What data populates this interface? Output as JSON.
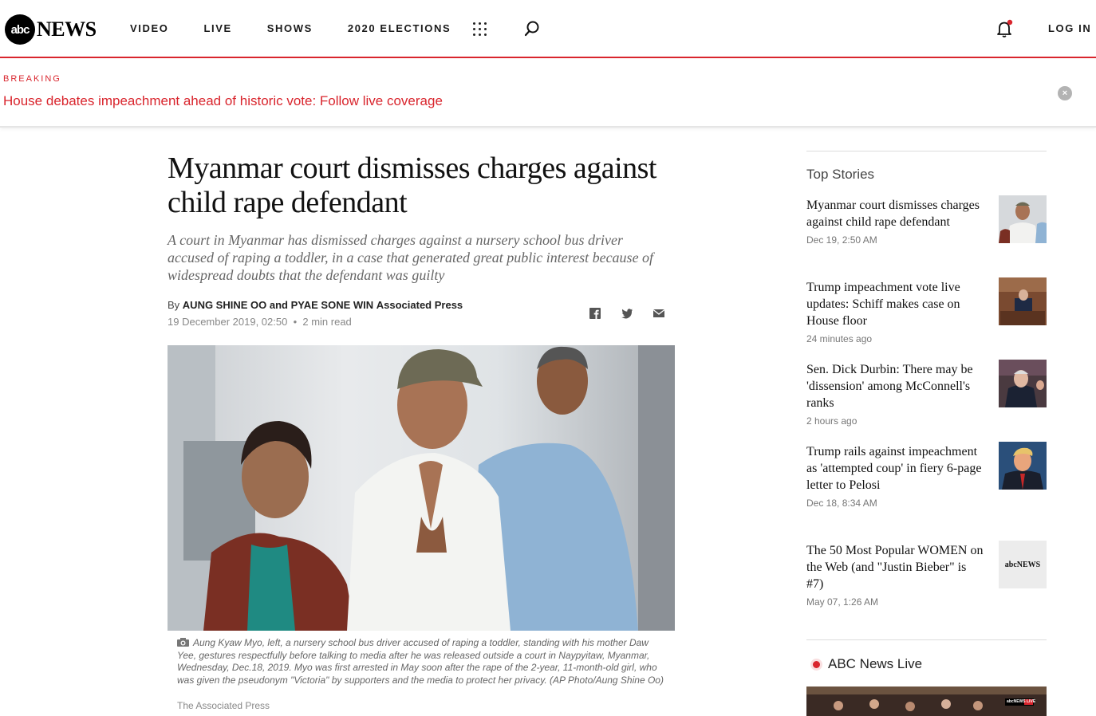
{
  "header": {
    "logo_abc": "abc",
    "logo_news": "NEWS",
    "nav": [
      "VIDEO",
      "LIVE",
      "SHOWS",
      "2020 ELECTIONS"
    ],
    "login": "LOG IN"
  },
  "breaking": {
    "label": "BREAKING",
    "headline": "House debates impeachment ahead of historic vote: Follow live coverage",
    "close": "×"
  },
  "article": {
    "title": "Myanmar court dismisses charges against child rape defendant",
    "deck": "A court in Myanmar has dismissed charges against a nursery school bus driver accused of raping a toddler, in a case that generated great public interest because of widespread doubts that the defendant was guilty",
    "by_prefix": "By",
    "authors": "AUNG SHINE OO and PYAE SONE WIN",
    "outlet": "Associated Press",
    "date": "19 December 2019, 02:50",
    "read_time": "2 min read",
    "caption": "Aung Kyaw Myo, left, a nursery school bus driver accused of raping a toddler, standing with his mother Daw Yee, gestures respectfully before talking to media after he was released outside a court in Naypyitaw, Myanmar, Wednesday, Dec.18, 2019. Myo was first arrested in May soon after the rape of the 2-year, 11-month-old girl, who was given the pseudonym \"Victoria\" by supporters and the media to protect her privacy. (AP Photo/Aung Shine Oo)",
    "credit": "The Associated Press"
  },
  "sidebar": {
    "title": "Top Stories",
    "stories": [
      {
        "headline": "Myanmar court dismisses charges against child rape defendant",
        "time": "Dec 19, 2:50 AM"
      },
      {
        "headline": "Trump impeachment vote live updates: Schiff makes case on House floor",
        "time": "24 minutes ago"
      },
      {
        "headline": "Sen. Dick Durbin: There may be 'dissension' among McConnell's ranks",
        "time": "2 hours ago"
      },
      {
        "headline": "Trump rails against impeachment as 'attempted coup' in fiery 6-page letter to Pelosi",
        "time": "Dec 18, 8:34 AM"
      },
      {
        "headline": "The 50 Most Popular WOMEN on the Web (and \"Justin Bieber\" is #7)",
        "time": "May 07, 1:26 AM"
      }
    ],
    "thumb_logo": "abcNEWS",
    "live_title": "ABC News Live",
    "live_badge": "abcNEWS LIVE"
  },
  "colors": {
    "accent": "#d9252d"
  }
}
